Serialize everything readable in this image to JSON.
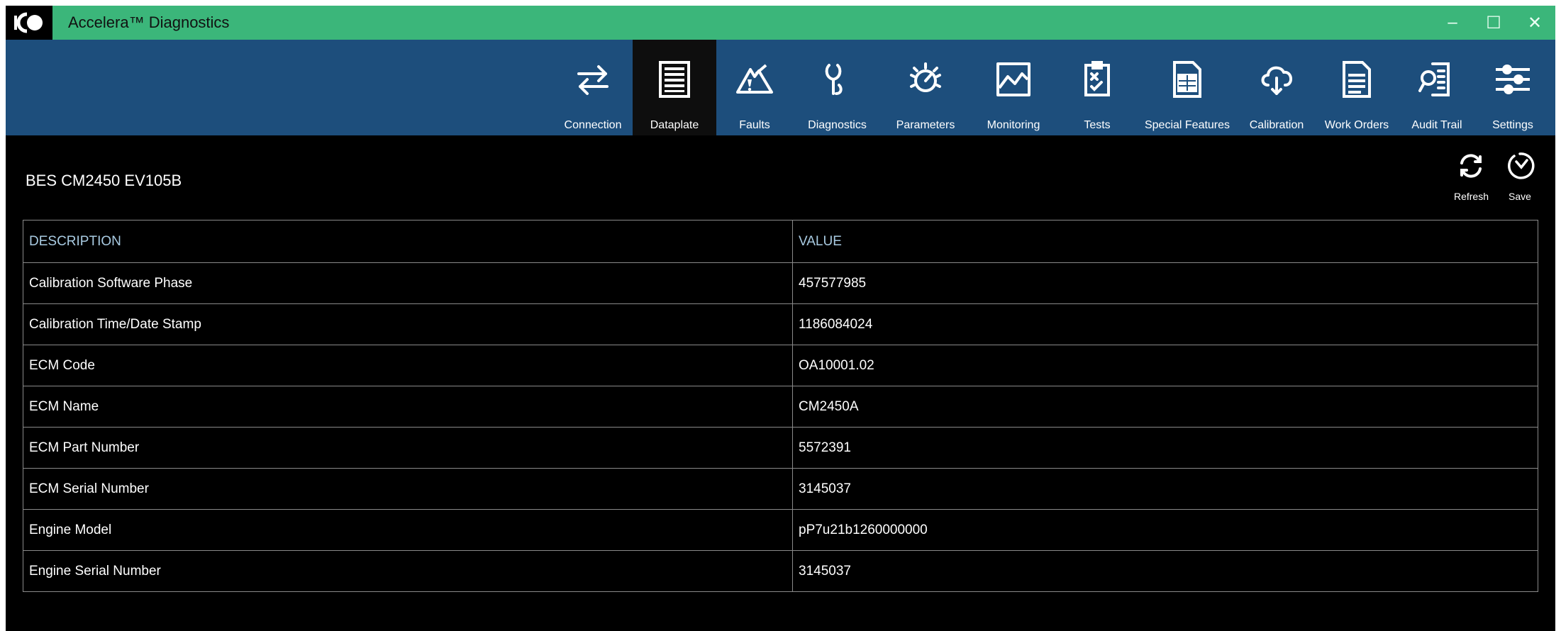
{
  "window": {
    "title": "Accelera™ Diagnostics",
    "controls": {
      "minimize": "–",
      "maximize": "☐",
      "close": "✕"
    }
  },
  "toolbar": {
    "items": [
      {
        "label": "Connection",
        "icon": "connection-icon",
        "active": false
      },
      {
        "label": "Dataplate",
        "icon": "dataplate-icon",
        "active": true
      },
      {
        "label": "Faults",
        "icon": "faults-icon",
        "active": false
      },
      {
        "label": "Diagnostics",
        "icon": "diagnostics-icon",
        "active": false
      },
      {
        "label": "Parameters",
        "icon": "parameters-icon",
        "active": false
      },
      {
        "label": "Monitoring",
        "icon": "monitoring-icon",
        "active": false
      },
      {
        "label": "Tests",
        "icon": "tests-icon",
        "active": false
      },
      {
        "label": "Special Features",
        "icon": "special-features-icon",
        "active": false
      },
      {
        "label": "Calibration",
        "icon": "calibration-icon",
        "active": false
      },
      {
        "label": "Work Orders",
        "icon": "work-orders-icon",
        "active": false
      },
      {
        "label": "Audit Trail",
        "icon": "audit-trail-icon",
        "active": false
      },
      {
        "label": "Settings",
        "icon": "settings-icon",
        "active": false
      }
    ]
  },
  "page": {
    "device_title": "BES CM2450 EV105B",
    "actions": {
      "refresh_label": "Refresh",
      "save_label": "Save"
    }
  },
  "table": {
    "headers": {
      "description": "DESCRIPTION",
      "value": "VALUE"
    },
    "rows": [
      {
        "description": "Calibration Software Phase",
        "value": "457577985"
      },
      {
        "description": "Calibration Time/Date Stamp",
        "value": "1186084024"
      },
      {
        "description": "ECM Code",
        "value": "OA10001.02"
      },
      {
        "description": "ECM Name",
        "value": "CM2450A"
      },
      {
        "description": "ECM Part Number",
        "value": "5572391"
      },
      {
        "description": "ECM Serial Number",
        "value": "3145037"
      },
      {
        "description": "Engine Model",
        "value": "pP7u21b1260000000"
      },
      {
        "description": "Engine Serial Number",
        "value": "3145037"
      }
    ]
  },
  "colors": {
    "titlebar": "#3bb67a",
    "toolbar": "#1d4e7c",
    "active_tab": "#0e0e0e",
    "background": "#000000",
    "header_text": "#a9cbe2"
  }
}
